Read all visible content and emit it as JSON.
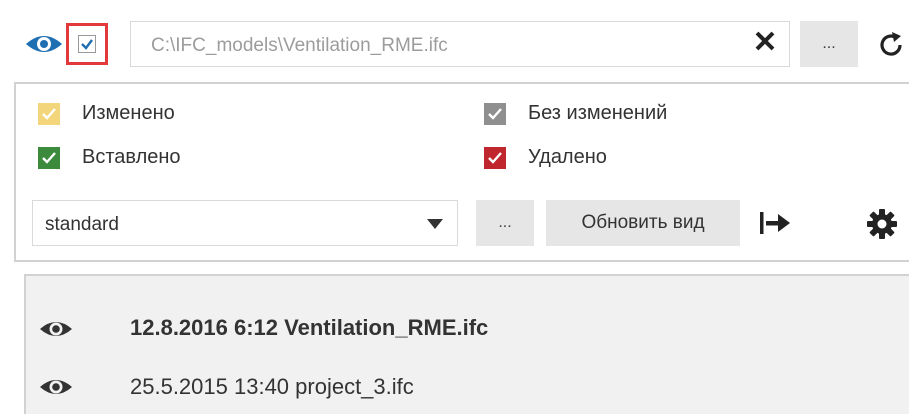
{
  "toolbar": {
    "file_path": "C:\\IFC_models\\Ventilation_RME.ifc",
    "browse_label": "...",
    "clear_icon": "close-icon",
    "refresh_icon": "refresh-icon",
    "visibility_icon": "eye-icon",
    "enabled_checked": true
  },
  "legend": {
    "modified_label": "Изменено",
    "unchanged_label": "Без изменений",
    "inserted_label": "Вставлено",
    "deleted_label": "Удалено",
    "colors": {
      "modified": "#f3d67b",
      "unchanged": "#8f8f8f",
      "inserted": "#3c8a3c",
      "deleted": "#c0262e"
    }
  },
  "view": {
    "selected": "standard",
    "more_label": "...",
    "update_label": "Обновить вид"
  },
  "files": [
    {
      "label": "12.8.2016 6:12 Ventilation_RME.ifc",
      "active": true
    },
    {
      "label": "25.5.2015 13:40 project_3.ifc",
      "active": false
    }
  ]
}
